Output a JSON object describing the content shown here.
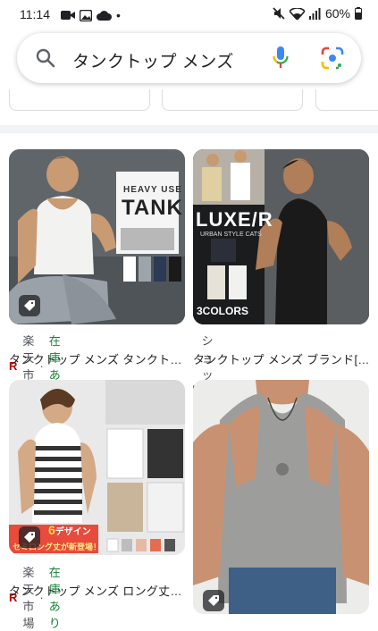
{
  "status_bar": {
    "time": "11:14",
    "dot": "•",
    "battery": "60%"
  },
  "search": {
    "query": "タンクトップ メンズ"
  },
  "results": [
    {
      "source": "楽天市場",
      "availability": "在庫あり",
      "title": "タンクトップ メンズ タンクト…",
      "image_text": [
        "HEAVY USE",
        "TANK"
      ]
    },
    {
      "source": "ショップリスト",
      "title": "タンクトップ メンズ ブランド[…",
      "image_text": [
        "LUXE/R",
        "URBAN STYLE CATS",
        "3COLORS"
      ]
    },
    {
      "source": "楽天市場",
      "availability": "在庫あり",
      "title": "タンクトップ メンズ ロング丈…",
      "image_text": [
        "6",
        "デザイン",
        "セミロング丈が新登場！"
      ]
    },
    {
      "source": "",
      "title": ""
    }
  ],
  "separator": "·",
  "colors": {
    "accent_blue": "#4285f4",
    "green": "#188038",
    "red": "#ea4335",
    "yellow": "#fbbc04"
  }
}
